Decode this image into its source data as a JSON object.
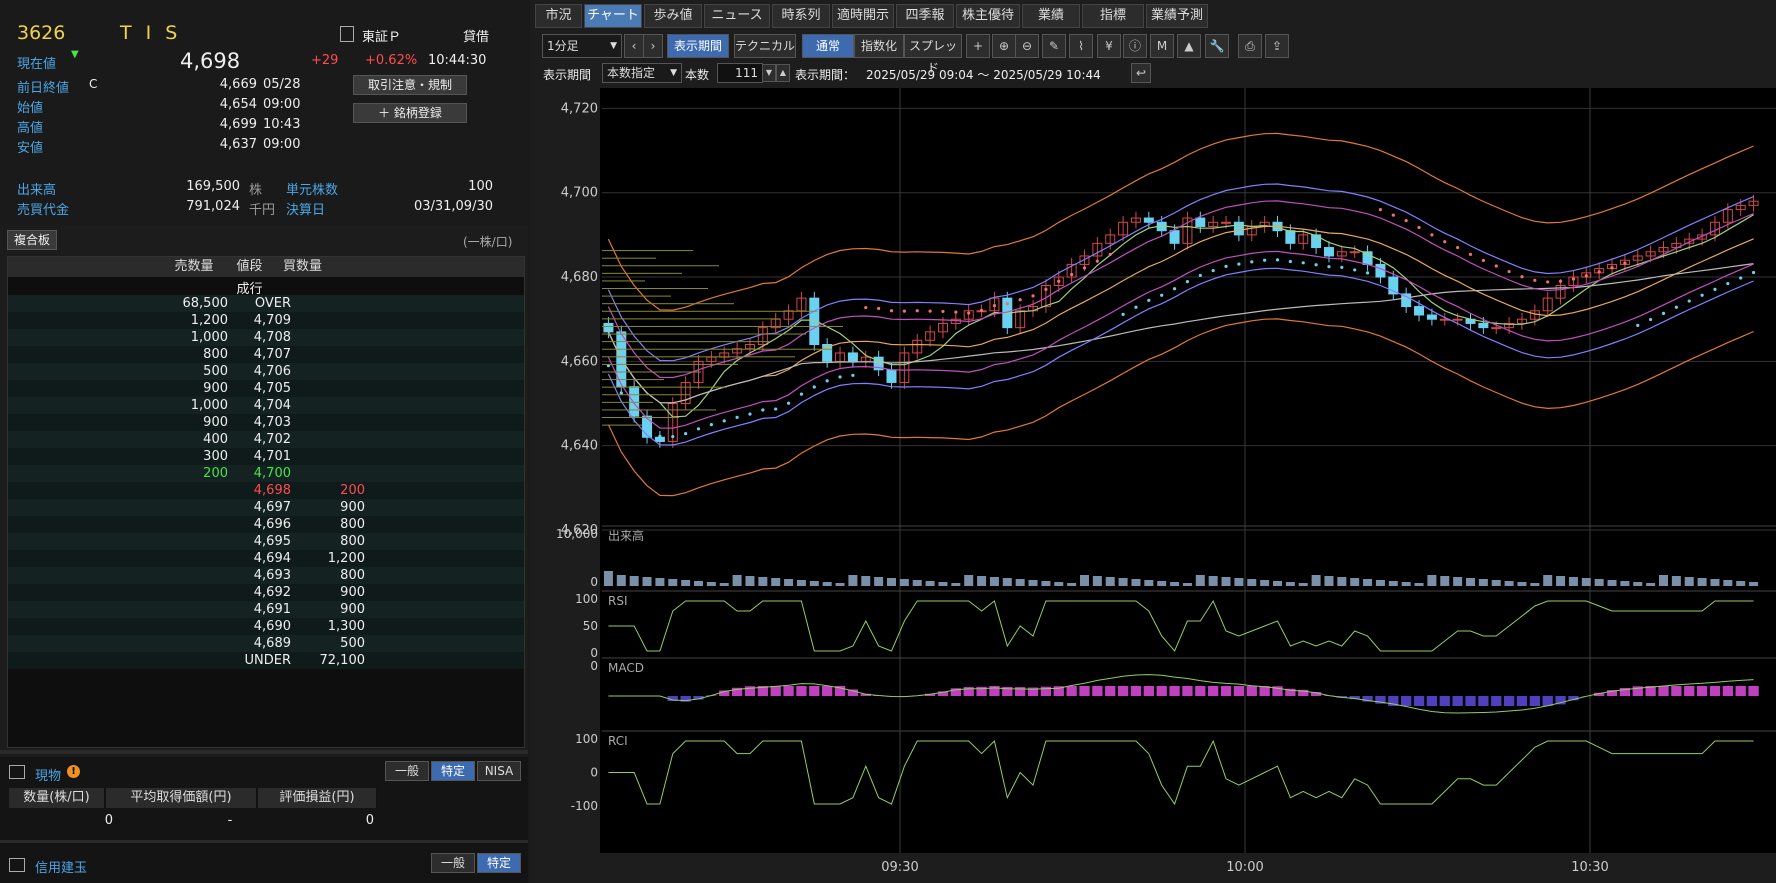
{
  "quote": {
    "code": "3626",
    "name": "T I S",
    "market": "東証Ｐ",
    "lending": "貸借",
    "price_label": "現在値",
    "price": "4,698",
    "change": "+29",
    "change_pct": "+0.62%",
    "time": "10:44:30",
    "rows": [
      {
        "label": "前日終値",
        "flag": "C",
        "value": "4,669",
        "time": "05/28"
      },
      {
        "label": "始値",
        "flag": "",
        "value": "4,654",
        "time": "09:00"
      },
      {
        "label": "高値",
        "flag": "",
        "value": "4,699",
        "time": "10:43"
      },
      {
        "label": "安値",
        "flag": "",
        "value": "4,637",
        "time": "09:00"
      }
    ],
    "btn_rules": "取引注意・規制",
    "btn_register": "銘柄登録",
    "volume_label": "出来高",
    "volume": "169,500",
    "volume_unit": "株",
    "unit_label": "単元株数",
    "unit": "100",
    "turnover_label": "売買代金",
    "turnover": "791,024",
    "turnover_unit": "千円",
    "settle_label": "決算日",
    "settle": "03/31,09/30"
  },
  "book": {
    "title": "複合板",
    "unit_note": "(一株/口)",
    "headers": [
      "売数量",
      "値段",
      "買数量"
    ],
    "market_label": "成行",
    "rows": [
      {
        "sell": "68,500",
        "price": "OVER",
        "buy": "",
        "c": "w"
      },
      {
        "sell": "1,200",
        "price": "4,709",
        "buy": "",
        "c": "w"
      },
      {
        "sell": "1,000",
        "price": "4,708",
        "buy": "",
        "c": "w"
      },
      {
        "sell": "800",
        "price": "4,707",
        "buy": "",
        "c": "w"
      },
      {
        "sell": "500",
        "price": "4,706",
        "buy": "",
        "c": "w"
      },
      {
        "sell": "900",
        "price": "4,705",
        "buy": "",
        "c": "w"
      },
      {
        "sell": "1,000",
        "price": "4,704",
        "buy": "",
        "c": "w"
      },
      {
        "sell": "900",
        "price": "4,703",
        "buy": "",
        "c": "w"
      },
      {
        "sell": "400",
        "price": "4,702",
        "buy": "",
        "c": "w"
      },
      {
        "sell": "300",
        "price": "4,701",
        "buy": "",
        "c": "w"
      },
      {
        "sell": "200",
        "price": "4,700",
        "buy": "",
        "c": "g"
      },
      {
        "sell": "",
        "price": "4,698",
        "buy": "200",
        "c": "r"
      },
      {
        "sell": "",
        "price": "4,697",
        "buy": "900",
        "c": "w"
      },
      {
        "sell": "",
        "price": "4,696",
        "buy": "800",
        "c": "w"
      },
      {
        "sell": "",
        "price": "4,695",
        "buy": "800",
        "c": "w"
      },
      {
        "sell": "",
        "price": "4,694",
        "buy": "1,200",
        "c": "w"
      },
      {
        "sell": "",
        "price": "4,693",
        "buy": "800",
        "c": "w"
      },
      {
        "sell": "",
        "price": "4,692",
        "buy": "900",
        "c": "w"
      },
      {
        "sell": "",
        "price": "4,691",
        "buy": "900",
        "c": "w"
      },
      {
        "sell": "",
        "price": "4,690",
        "buy": "1,300",
        "c": "w"
      },
      {
        "sell": "",
        "price": "4,689",
        "buy": "500",
        "c": "w"
      },
      {
        "sell": "",
        "price": "UNDER",
        "buy": "72,100",
        "c": "w"
      }
    ]
  },
  "holdings": {
    "title": "現物",
    "tabs": [
      "一般",
      "特定",
      "NISA"
    ],
    "headers": [
      "数量(株/口)",
      "平均取得価額(円)",
      "評価損益(円)"
    ],
    "values": [
      "0",
      "-",
      "0"
    ],
    "margin_title": "信用建玉",
    "margin_tabs": [
      "一般",
      "特定"
    ]
  },
  "tabs": [
    "市況",
    "チャート",
    "歩み値",
    "ニュース",
    "時系列",
    "適時開示",
    "四季報",
    "株主優待",
    "業績",
    "指標",
    "業績予測"
  ],
  "toolbar": {
    "interval": "1分足",
    "period_btn": "表示期間",
    "tech_btn": "テクニカル",
    "normal_btn": "通常",
    "index_btn": "指数化",
    "spread_btn": "スプレッド",
    "period_label": "表示期間",
    "period_mode": "本数指定",
    "count_label": "本数",
    "count": "111",
    "range_label": "表示期間：",
    "range": "2025/05/29 09:04 〜 2025/05/29 10:44"
  },
  "colors": {
    "up": "#d4474b",
    "down": "#6ad2f0",
    "bg": "#000000",
    "grid": "#3a3a3a"
  },
  "chart_data": [
    {
      "type": "candlestick",
      "title": "",
      "yticks": [
        "4,720",
        "4,700",
        "4,680",
        "4,660",
        "4,640",
        "4,620"
      ],
      "ylim": [
        4620,
        4722
      ],
      "xticks": [
        "09:30",
        "10:00",
        "10:30"
      ],
      "close": [
        4667,
        4654,
        4647,
        4642,
        4641,
        4650,
        4655,
        4660,
        4661,
        4662,
        4663,
        4664,
        4668,
        4670,
        4672,
        4675,
        4664,
        4660,
        4662,
        4660,
        4661,
        4658,
        4655,
        4662,
        4665,
        4667,
        4669,
        4670,
        4672,
        4672,
        4675,
        4668,
        4672,
        4673,
        4678,
        4680,
        4683,
        4685,
        4688,
        4690,
        4693,
        4694,
        4693,
        4691,
        4688,
        4694,
        4692,
        4693,
        4693,
        4690,
        4692,
        4693,
        4691,
        4688,
        4690,
        4687,
        4685,
        4686,
        4686,
        4683,
        4680,
        4676,
        4673,
        4671,
        4670,
        4670,
        4670,
        4669,
        4668,
        4668,
        4669,
        4670,
        4672,
        4675,
        4678,
        4680,
        4681,
        4682,
        4683,
        4684,
        4685,
        4686,
        4687,
        4688,
        4689,
        4690,
        4693,
        4696,
        4697,
        4698
      ],
      "psar_color": "#f07070"
    },
    {
      "type": "bar",
      "title": "出来高",
      "yticks": [
        "10,000",
        "0"
      ]
    },
    {
      "type": "line",
      "title": "RSI",
      "yticks": [
        "100",
        "50",
        "0"
      ]
    },
    {
      "type": "line",
      "title": "MACD",
      "yticks": [
        "0"
      ]
    },
    {
      "type": "line",
      "title": "RCI",
      "yticks": [
        "100",
        "0",
        "-100"
      ]
    }
  ]
}
